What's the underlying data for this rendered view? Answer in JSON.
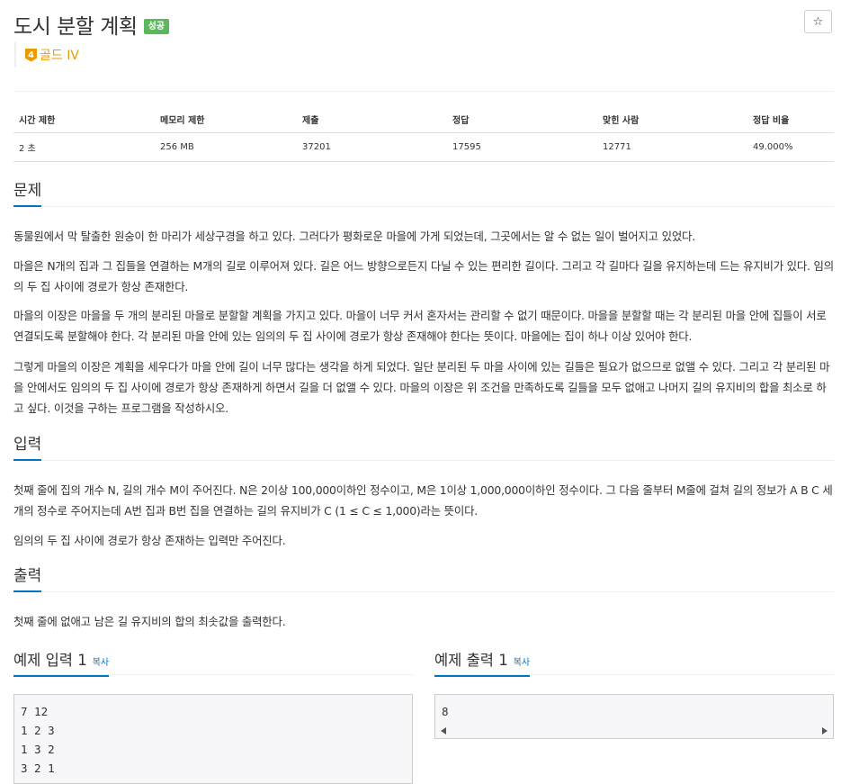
{
  "header": {
    "title": "도시 분할 계획",
    "badge": "성공",
    "star": "☆",
    "tier_number": "4",
    "tier_label": "골드 IV"
  },
  "info_table": {
    "headers": [
      "시간 제한",
      "메모리 제한",
      "제출",
      "정답",
      "맞힌 사람",
      "정답 비율"
    ],
    "values": [
      "2 초",
      "256 MB",
      "37201",
      "17595",
      "12771",
      "49.000%"
    ]
  },
  "sections": {
    "problem": {
      "title": "문제",
      "paragraphs": [
        "동물원에서 막 탈출한 원숭이 한 마리가 세상구경을 하고 있다. 그러다가 평화로운 마을에 가게 되었는데, 그곳에서는 알 수 없는 일이 벌어지고 있었다.",
        "마을은 N개의 집과 그 집들을 연결하는 M개의 길로 이루어져 있다. 길은 어느 방향으로든지 다닐 수 있는 편리한 길이다. 그리고 각 길마다 길을 유지하는데 드는 유지비가 있다. 임의의 두 집 사이에 경로가 항상 존재한다.",
        "마을의 이장은 마을을 두 개의 분리된 마을로 분할할 계획을 가지고 있다. 마을이 너무 커서 혼자서는 관리할 수 없기 때문이다. 마을을 분할할 때는 각 분리된 마을 안에 집들이 서로 연결되도록 분할해야 한다. 각 분리된 마을 안에 있는 임의의 두 집 사이에 경로가 항상 존재해야 한다는 뜻이다. 마을에는 집이 하나 이상 있어야 한다.",
        "그렇게 마을의 이장은 계획을 세우다가 마을 안에 길이 너무 많다는 생각을 하게 되었다. 일단 분리된 두 마을 사이에 있는 길들은 필요가 없으므로 없앨 수 있다. 그리고 각 분리된 마을 안에서도 임의의 두 집 사이에 경로가 항상 존재하게 하면서 길을 더 없앨 수 있다. 마을의 이장은 위 조건을 만족하도록 길들을 모두 없애고 나머지 길의 유지비의 합을 최소로 하고 싶다. 이것을 구하는 프로그램을 작성하시오."
      ]
    },
    "input": {
      "title": "입력",
      "paragraphs": [
        "첫째 줄에 집의 개수 N, 길의 개수 M이 주어진다. N은 2이상 100,000이하인 정수이고, M은 1이상 1,000,000이하인 정수이다. 그 다음 줄부터 M줄에 걸쳐 길의 정보가 A B C 세 개의 정수로 주어지는데 A번 집과 B번 집을 연결하는 길의 유지비가 C (1 ≤ C ≤ 1,000)라는 뜻이다.",
        "임의의 두 집 사이에 경로가 항상 존재하는 입력만 주어진다."
      ]
    },
    "output": {
      "title": "출력",
      "paragraphs": [
        "첫째 줄에 없애고 남은 길 유지비의 합의 최솟값을 출력한다."
      ]
    }
  },
  "samples": {
    "input": {
      "title": "예제 입력 1",
      "copy": "복사",
      "lines": [
        "7 12",
        "1 2 3",
        "1 3 2",
        "3 2 1"
      ]
    },
    "output": {
      "title": "예제 출력 1",
      "copy": "복사",
      "lines": [
        "8"
      ]
    }
  }
}
